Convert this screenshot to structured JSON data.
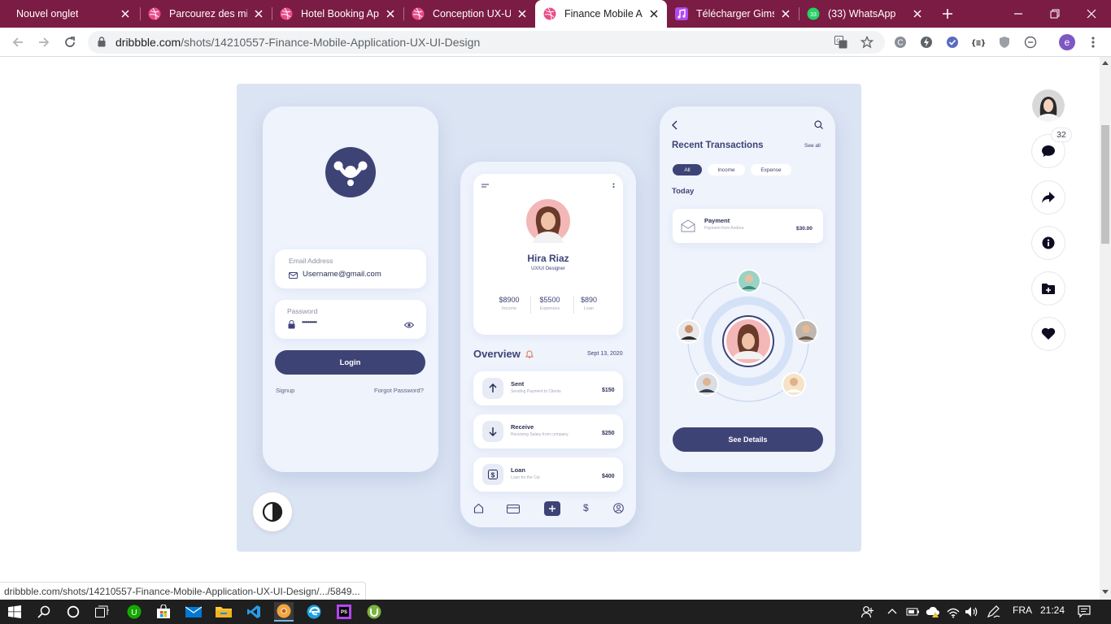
{
  "browser": {
    "tabs": [
      {
        "title": "Nouvel onglet",
        "icon": "blank-icon"
      },
      {
        "title": "Parcourez des mill",
        "icon": "dribbble-icon"
      },
      {
        "title": "Hotel Booking App",
        "icon": "dribbble-icon"
      },
      {
        "title": "Conception UX-UI",
        "icon": "dribbble-icon"
      },
      {
        "title": "Finance Mobile Ap",
        "icon": "dribbble-icon",
        "active": true
      },
      {
        "title": "Télécharger Gims",
        "icon": "music-icon"
      },
      {
        "title": "(33) WhatsApp",
        "icon": "whatsapp-icon"
      }
    ],
    "url_domain": "dribbble.com",
    "url_path": "/shots/14210557-Finance-Mobile-Application-UX-UI-Design",
    "profile_initial": "e",
    "status_url": "dribbble.com/shots/14210557-Finance-Mobile-Application-UX-UI-Design/.../5849..."
  },
  "shot": {
    "login": {
      "email_label": "Email Address",
      "email_value": "Username@gmail.com",
      "password_label": "Password",
      "password_value": "••••••••••",
      "login_button": "Login",
      "signup": "Signup",
      "forgot": "Forgot Password?"
    },
    "profile": {
      "name": "Hira Riaz",
      "role": "UX/UI Designer",
      "stats": [
        {
          "value": "$8900",
          "label": "Income"
        },
        {
          "value": "$5500",
          "label": "Expenses"
        },
        {
          "value": "$890",
          "label": "Loan"
        }
      ],
      "overview_title": "Overview",
      "overview_date": "Sept 13, 2020",
      "transactions": [
        {
          "title": "Sent",
          "sub": "Sending Payment to Clients",
          "amount": "$150",
          "icon": "arrow-up-icon"
        },
        {
          "title": "Receive",
          "sub": "Receiving Salary from company",
          "amount": "$250",
          "icon": "arrow-down-icon"
        },
        {
          "title": "Loan",
          "sub": "Loan for the Car",
          "amount": "$400",
          "icon": "dollar-box-icon"
        }
      ]
    },
    "recent": {
      "title": "Recent Transactions",
      "see_all": "See all",
      "filters": [
        "All",
        "Income",
        "Expense"
      ],
      "today": "Today",
      "payment_title": "Payment",
      "payment_sub": "Payment from Andrea",
      "payment_amount": "$30.00",
      "see_details": "See Details"
    }
  },
  "sidebar": {
    "comment_count": "32"
  },
  "taskbar": {
    "language": "FRA",
    "time": "21:24"
  },
  "colors": {
    "tabstrip": "#7b1c44",
    "navy": "#3e4376",
    "shot_bg": "#dbe4f3"
  }
}
